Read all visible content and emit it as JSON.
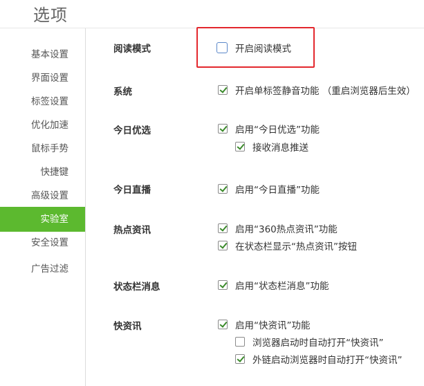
{
  "header": {
    "title": "选项"
  },
  "sidebar": {
    "items": [
      {
        "label": "基本设置"
      },
      {
        "label": "界面设置"
      },
      {
        "label": "标签设置"
      },
      {
        "label": "优化加速"
      },
      {
        "label": "鼠标手势"
      },
      {
        "label": "快捷键"
      },
      {
        "label": "高级设置"
      },
      {
        "label": "实验室",
        "active": true
      },
      {
        "label": "安全设置"
      },
      {
        "label": "广告过滤"
      }
    ]
  },
  "sections": [
    {
      "label": "阅读模式",
      "options": [
        {
          "text": "开启阅读模式",
          "checked": false
        }
      ]
    },
    {
      "label": "系统",
      "options": [
        {
          "text": "开启单标签静音功能 （重启浏览器后生效）",
          "checked": true
        }
      ]
    },
    {
      "label": "今日优选",
      "options": [
        {
          "text": "启用“今日优选”功能",
          "checked": true
        },
        {
          "text": "接收消息推送",
          "checked": true
        }
      ]
    },
    {
      "label": "今日直播",
      "options": [
        {
          "text": "启用“今日直播”功能",
          "checked": true
        }
      ]
    },
    {
      "label": "热点资讯",
      "options": [
        {
          "text": "启用“360热点资讯”功能",
          "checked": true
        },
        {
          "text": "在状态栏显示“热点资讯”按钮",
          "checked": true
        }
      ]
    },
    {
      "label": "状态栏消息",
      "options": [
        {
          "text": "启用“状态栏消息”功能",
          "checked": true
        }
      ]
    },
    {
      "label": "快资讯",
      "options": [
        {
          "text": "启用“快资讯”功能",
          "checked": true
        },
        {
          "text": "浏览器启动时自动打开“快资讯”",
          "checked": false
        },
        {
          "text": "外链启动浏览器时自动打开“快资讯”",
          "checked": true
        }
      ]
    }
  ],
  "colors": {
    "accent": "#5cb92f",
    "highlight": "#e3272d"
  }
}
